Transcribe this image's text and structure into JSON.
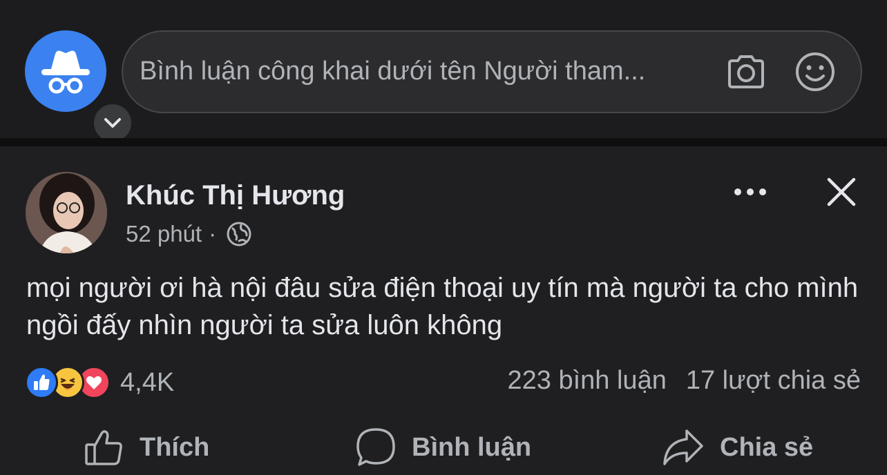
{
  "composer": {
    "placeholder": "Bình luận công khai dưới tên Người tham...",
    "avatar_icon": "anonymous-participant-icon",
    "switch_icon": "chevron-down-icon",
    "camera_icon": "camera-icon",
    "emoji_icon": "smile-icon"
  },
  "post": {
    "author": "Khúc Thị Hương",
    "time": "52 phút",
    "separator": "·",
    "privacy_icon": "globe-icon",
    "text": "mọi người ơi hà nội đâu sửa điện thoại uy tín mà người ta cho mình ngồi đấy nhìn người ta sửa luôn không",
    "reactions": {
      "types": [
        "like",
        "haha",
        "love"
      ],
      "count": "4,4K"
    },
    "comments_count": "223 bình luận",
    "shares_count": "17 lượt chia sẻ"
  },
  "actions": {
    "like": "Thích",
    "comment": "Bình luận",
    "share": "Chia sẻ"
  },
  "colors": {
    "background": "#1f1f21",
    "accent_blue": "#3b82f0",
    "text_primary": "#e4e6eb",
    "text_secondary": "#b0b3b8"
  }
}
